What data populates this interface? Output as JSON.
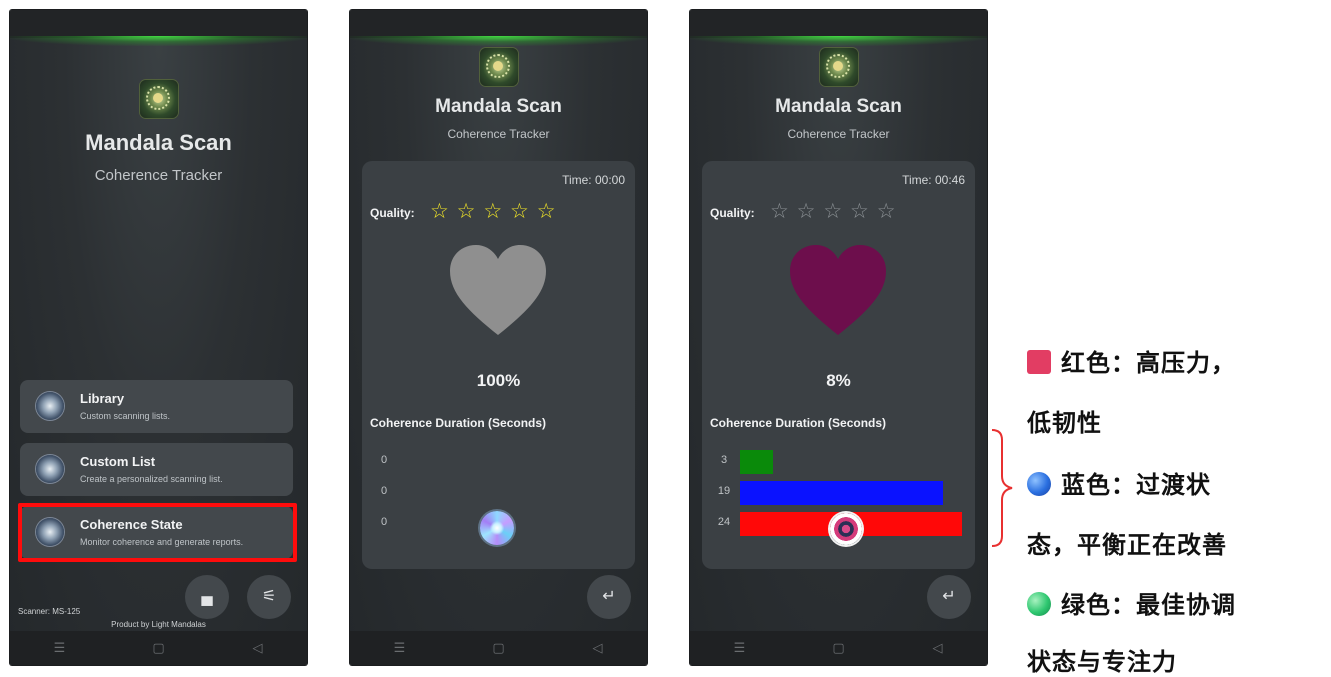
{
  "app": {
    "title": "Mandala Scan",
    "subtitle": "Coherence Tracker"
  },
  "phone1": {
    "menu": [
      {
        "title": "Library",
        "desc": "Custom scanning lists."
      },
      {
        "title": "Custom List",
        "desc": "Create a personalized scanning list."
      },
      {
        "title": "Coherence State",
        "desc": "Monitor coherence and generate reports."
      }
    ],
    "scanner": "Scanner: MS-125",
    "product": "Product by Light Mandalas"
  },
  "phone2": {
    "time": "Time: 00:00",
    "quality_label": "Quality:",
    "stars": [
      "☆",
      "☆",
      "☆",
      "☆",
      "☆"
    ],
    "percent": "100%",
    "duration_title": "Coherence Duration (Seconds)",
    "rows": [
      "0",
      "0",
      "0"
    ],
    "heart_color": "#8f8f8f"
  },
  "phone3": {
    "time": "Time: 00:46",
    "quality_label": "Quality:",
    "stars": [
      "☆",
      "☆",
      "☆",
      "☆",
      "☆"
    ],
    "percent": "8%",
    "duration_title": "Coherence Duration (Seconds)",
    "rows": [
      "3",
      "19",
      "24"
    ],
    "heart_color": "#6d0e4c",
    "bar_colors": [
      "#0a8a0a",
      "#0a12ff",
      "#ff0808"
    ]
  },
  "nav": {
    "menu": "☰",
    "home": "▢",
    "back": "◁"
  },
  "icons": {
    "store": "▄",
    "settings": "⚟",
    "return": "↵"
  },
  "legend": {
    "red_line1": "红色：高压力，",
    "red_line2": "低韧性",
    "blue_line1": "蓝色：过渡状",
    "blue_line2": "态，平衡正在改善",
    "green_line1": "绿色：最佳协调",
    "green_line2": "状态与专注力",
    "colors": {
      "red": "#e23d63",
      "blue": "#2a6fe0",
      "green": "#2ec770"
    }
  }
}
